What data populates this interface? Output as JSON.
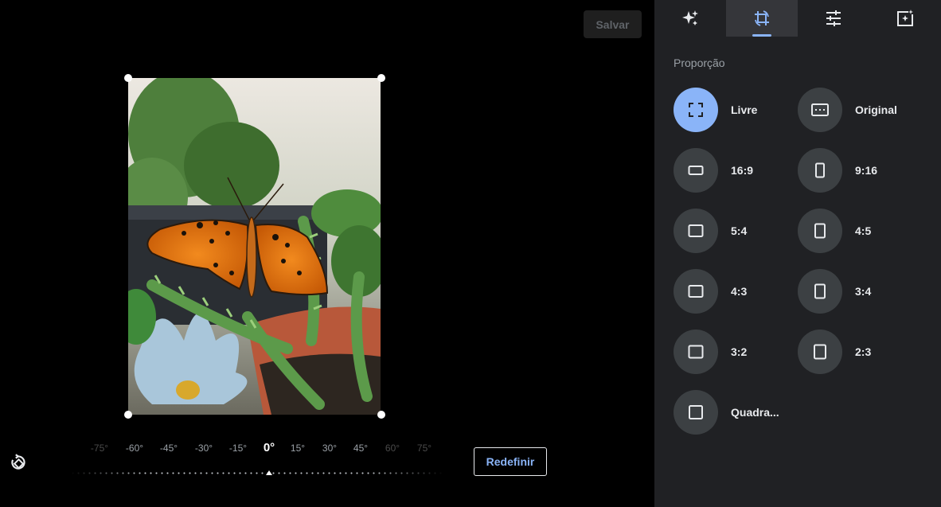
{
  "toolbar": {
    "save_label": "Salvar"
  },
  "tabs": [
    {
      "name": "auto-enhance",
      "icon": "sparkles-icon"
    },
    {
      "name": "crop-rotate",
      "icon": "crop-rotate-icon",
      "active": true
    },
    {
      "name": "adjust",
      "icon": "sliders-icon"
    },
    {
      "name": "filters",
      "icon": "filters-icon"
    }
  ],
  "panel": {
    "section_title": "Proporção",
    "options": [
      {
        "label": "Livre",
        "icon": "free-crop-icon",
        "active": true
      },
      {
        "label": "Original",
        "icon": "original-aspect-icon"
      },
      {
        "label": "16:9",
        "icon": "landscape-icon"
      },
      {
        "label": "9:16",
        "icon": "portrait-icon"
      },
      {
        "label": "5:4",
        "icon": "landscape-icon"
      },
      {
        "label": "4:5",
        "icon": "portrait-icon"
      },
      {
        "label": "4:3",
        "icon": "landscape-icon"
      },
      {
        "label": "3:4",
        "icon": "portrait-icon"
      },
      {
        "label": "3:2",
        "icon": "landscape-icon"
      },
      {
        "label": "2:3",
        "icon": "portrait-icon"
      },
      {
        "label": "Quadra...",
        "icon": "square-icon"
      }
    ]
  },
  "rotation": {
    "ticks": [
      "-75°",
      "-60°",
      "-45°",
      "-30°",
      "-15°",
      "0°",
      "15°",
      "30°",
      "45°",
      "60°",
      "75°"
    ],
    "current": "0°"
  },
  "reset_label": "Redefinir",
  "colors": {
    "accent": "#8ab4f8",
    "panel_bg": "#202124",
    "chip_bg": "#3c4043"
  }
}
